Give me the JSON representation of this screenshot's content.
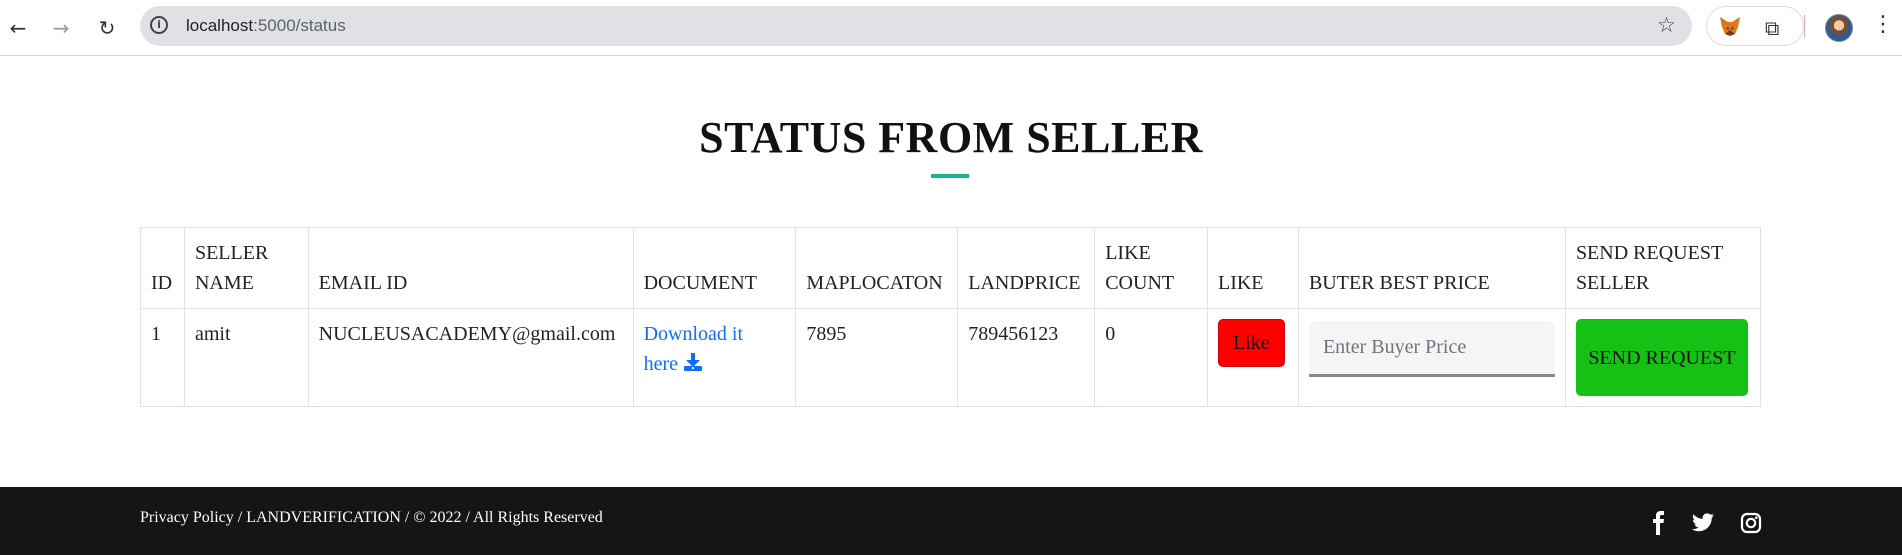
{
  "browser": {
    "url_host": "localhost",
    "url_path": ":5000/status"
  },
  "page": {
    "title": "STATUS FROM SELLER",
    "accent_color": "#1ab394"
  },
  "table": {
    "headers": [
      "ID",
      "SELLER NAME",
      "EMAIL ID",
      "DOCUMENT",
      "MAPLOCATON",
      "LANDPRICE",
      "LIKE COUNT",
      "LIKE",
      "BUTER BEST PRICE",
      "SEND REQUEST SELLER"
    ],
    "rows": [
      {
        "id": "1",
        "seller_name": "amit",
        "email": "NUCLEUSACADEMY@gmail.com",
        "document_link": "Download it here",
        "map_location": "7895",
        "land_price": "789456123",
        "like_count": "0",
        "like_label": "Like",
        "price_placeholder": "Enter Buyer Price",
        "send_label": "SEND REQUEST"
      }
    ]
  },
  "footer": {
    "text": "Privacy Policy / LANDVERIFICATION / © 2022 / All Rights Reserved",
    "social_icons": [
      "facebook-icon",
      "twitter-icon",
      "instagram-icon"
    ]
  }
}
